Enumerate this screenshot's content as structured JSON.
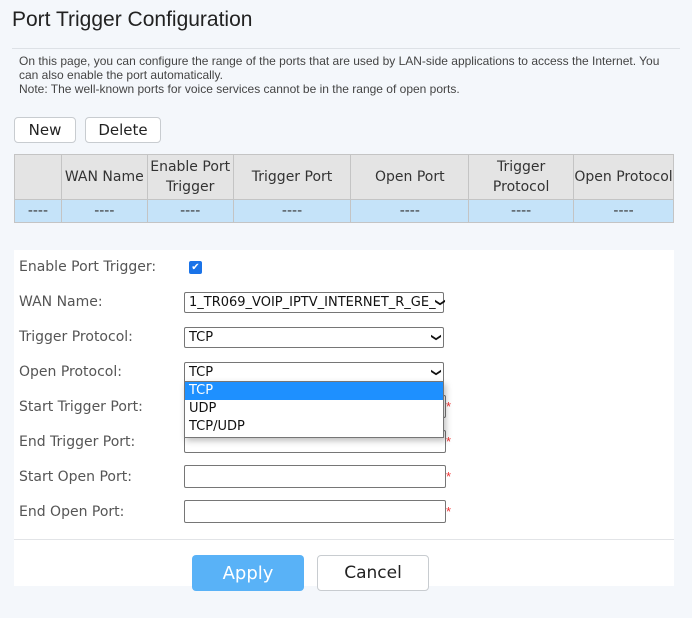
{
  "header": {
    "title": "Port Trigger Configuration",
    "description_line1": "On this page, you can configure the range of the ports that are used by LAN-side applications to access the Internet. You can also enable the port automatically.",
    "description_line2": "Note: The well-known ports for voice services cannot be in the range of open ports."
  },
  "toolbar": {
    "new_label": "New",
    "delete_label": "Delete"
  },
  "table": {
    "columns": [
      "",
      "WAN Name",
      "Enable Port Trigger",
      "Trigger Port",
      "Open Port",
      "Trigger Protocol",
      "Open Protocol"
    ],
    "rows": [
      [
        "----",
        "----",
        "----",
        "----",
        "----",
        "----",
        "----"
      ]
    ]
  },
  "form": {
    "enable_label": "Enable Port Trigger:",
    "enable_checked": true,
    "enable_check_glyph": "✔",
    "wan_label": "WAN Name:",
    "wan_value": "1_TR069_VOIP_IPTV_INTERNET_R_GE_",
    "trigger_protocol_label": "Trigger Protocol:",
    "trigger_protocol_value": "TCP",
    "open_protocol_label": "Open Protocol:",
    "open_protocol_value": "TCP",
    "open_protocol_options": [
      "TCP",
      "UDP",
      "TCP/UDP"
    ],
    "start_trigger_label": "Start Trigger Port:",
    "end_trigger_label": "End Trigger Port:",
    "start_open_label": "Start Open Port:",
    "end_open_label": "End Open Port:",
    "start_trigger_value": "",
    "end_trigger_value": "",
    "start_open_value": "",
    "end_open_value": "",
    "required_mark": "*",
    "chevron_glyph": "❯"
  },
  "actions": {
    "apply_label": "Apply",
    "cancel_label": "Cancel"
  },
  "colors": {
    "accent": "#59b2f7",
    "selected_option": "#1e90ff",
    "row_highlight": "#c5e3f9",
    "required": "#ee3333"
  }
}
